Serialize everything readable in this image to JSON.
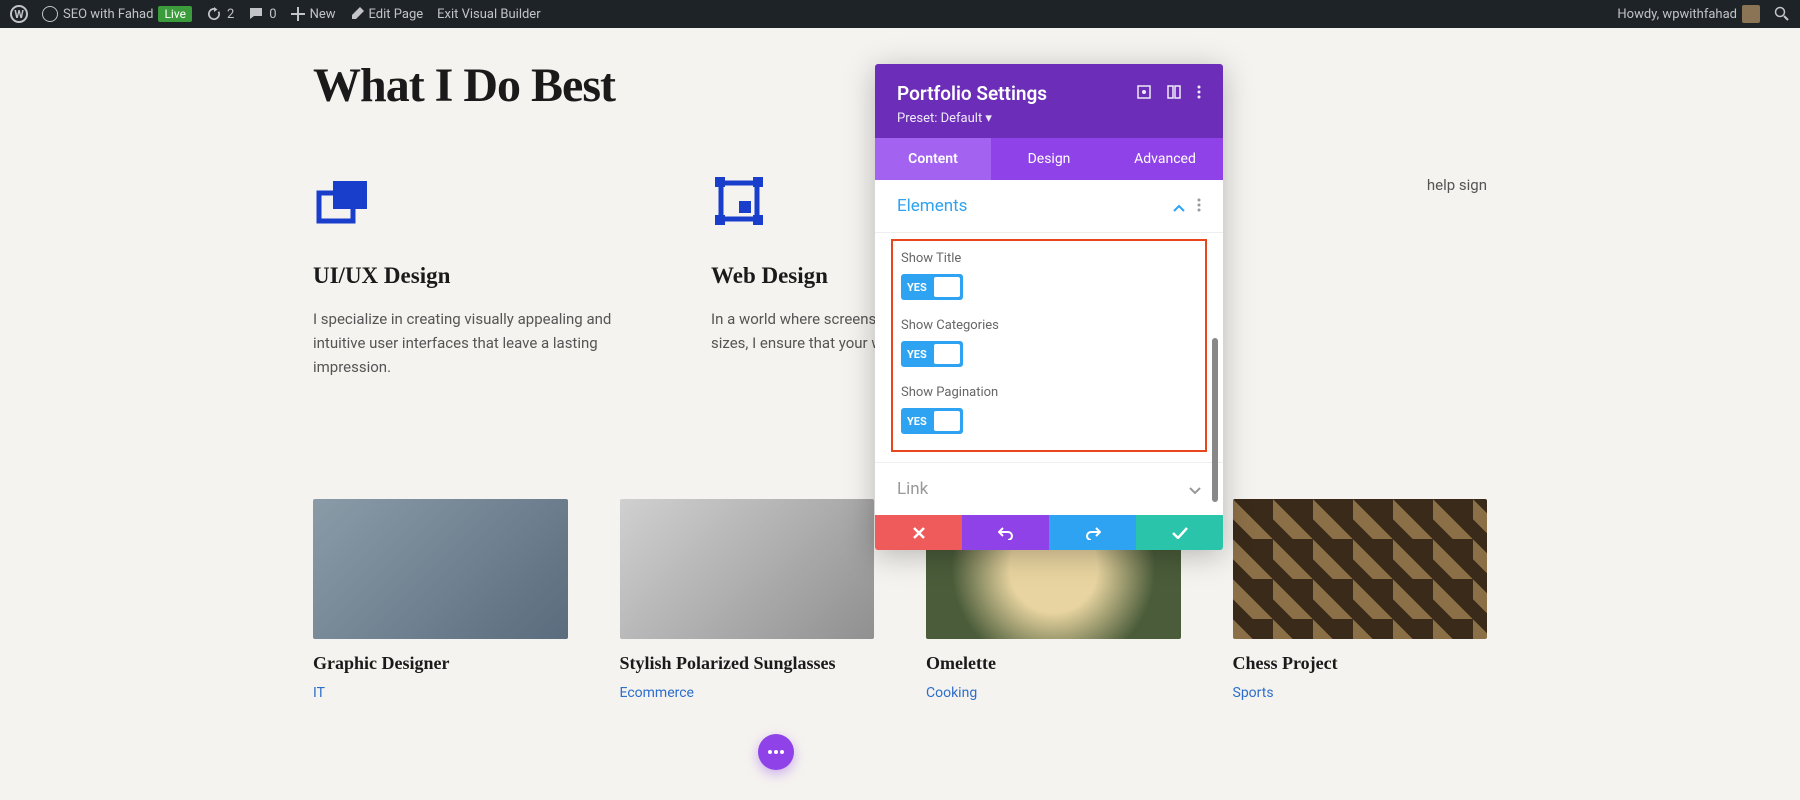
{
  "adminBar": {
    "siteName": "SEO with Fahad",
    "liveBadge": "Live",
    "updateCount": "2",
    "commentCount": "0",
    "newLabel": "New",
    "editPage": "Edit Page",
    "exitBuilder": "Exit Visual Builder",
    "howdy": "Howdy, wpwithfahad"
  },
  "page": {
    "title": "What I Do Best"
  },
  "services": [
    {
      "title": "UI/UX Design",
      "desc": "I specialize in creating visually appealing and intuitive user interfaces that leave a lasting impression."
    },
    {
      "title": "Web Design",
      "desc": "In a world where screens come in all and sizes, I ensure that your website functional."
    },
    {
      "title": "",
      "desc": "help sign"
    }
  ],
  "portfolio": [
    {
      "title": "Graphic Designer",
      "category": "IT"
    },
    {
      "title": "Stylish Polarized Sunglasses",
      "category": "Ecommerce"
    },
    {
      "title": "Omelette",
      "category": "Cooking"
    },
    {
      "title": "Chess Project",
      "category": "Sports"
    }
  ],
  "panel": {
    "title": "Portfolio Settings",
    "preset": "Preset: Default ▾",
    "tabs": {
      "content": "Content",
      "design": "Design",
      "advanced": "Advanced"
    },
    "sections": {
      "elements": "Elements",
      "link": "Link"
    },
    "settings": {
      "showTitle": "Show Title",
      "showCategories": "Show Categories",
      "showPagination": "Show Pagination",
      "yes": "YES"
    }
  }
}
